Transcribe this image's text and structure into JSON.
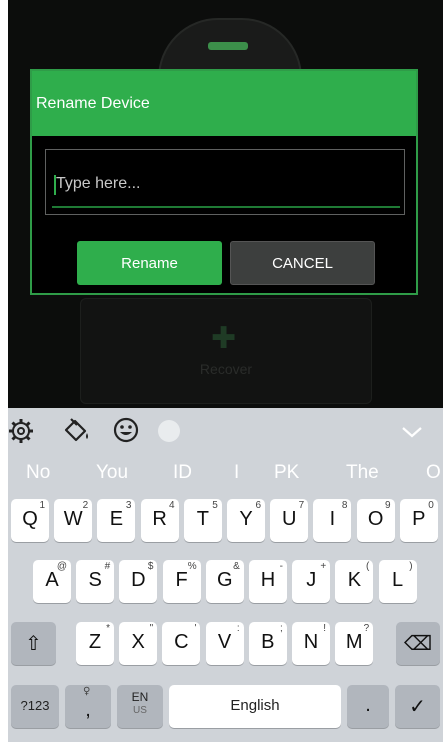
{
  "dialog": {
    "title": "Rename Device",
    "input_placeholder": "Type here...",
    "input_value": "",
    "rename_label": "Rename",
    "cancel_label": "CANCEL"
  },
  "background": {
    "recover_label": "Recover"
  },
  "keyboard": {
    "suggestions": [
      "No",
      "You",
      "ID",
      "I",
      "PK",
      "The",
      "O"
    ],
    "row1": [
      {
        "k": "Q",
        "h": "1"
      },
      {
        "k": "W",
        "h": "2"
      },
      {
        "k": "E",
        "h": "3"
      },
      {
        "k": "R",
        "h": "4"
      },
      {
        "k": "T",
        "h": "5"
      },
      {
        "k": "Y",
        "h": "6"
      },
      {
        "k": "U",
        "h": "7"
      },
      {
        "k": "I",
        "h": "8"
      },
      {
        "k": "O",
        "h": "9"
      },
      {
        "k": "P",
        "h": "0"
      }
    ],
    "row2": [
      {
        "k": "A",
        "h": "@"
      },
      {
        "k": "S",
        "h": "#"
      },
      {
        "k": "D",
        "h": "$"
      },
      {
        "k": "F",
        "h": "%"
      },
      {
        "k": "G",
        "h": "&"
      },
      {
        "k": "H",
        "h": "-"
      },
      {
        "k": "J",
        "h": "+"
      },
      {
        "k": "K",
        "h": "("
      },
      {
        "k": "L",
        "h": ")"
      }
    ],
    "row3": [
      {
        "k": "Z",
        "h": "*"
      },
      {
        "k": "X",
        "h": "\""
      },
      {
        "k": "C",
        "h": "'"
      },
      {
        "k": "V",
        "h": ":"
      },
      {
        "k": "B",
        "h": ";"
      },
      {
        "k": "N",
        "h": "!"
      },
      {
        "k": "M",
        "h": "?"
      }
    ],
    "symbols_label": "?123",
    "comma_label": ",",
    "lang_label": "EN",
    "lang_sub": "US",
    "space_label": "English",
    "period_label": ".",
    "shift_glyph": "⇧",
    "backspace_glyph": "⌫",
    "enter_glyph": "✓",
    "mic_glyph": "♀",
    "gear_glyph": "⚙",
    "chevron_glyph": "⌄"
  },
  "icons": [
    "gear-icon",
    "paint-bucket-icon",
    "emoji-icon",
    "theme-icon",
    "chevron-down-icon",
    "shift-icon",
    "backspace-icon",
    "check-icon",
    "microphone-icon"
  ],
  "colors": {
    "accent": "#2fae4c",
    "dialog_bg": "#000000",
    "keyboard_bg": "#cfd3d8"
  }
}
